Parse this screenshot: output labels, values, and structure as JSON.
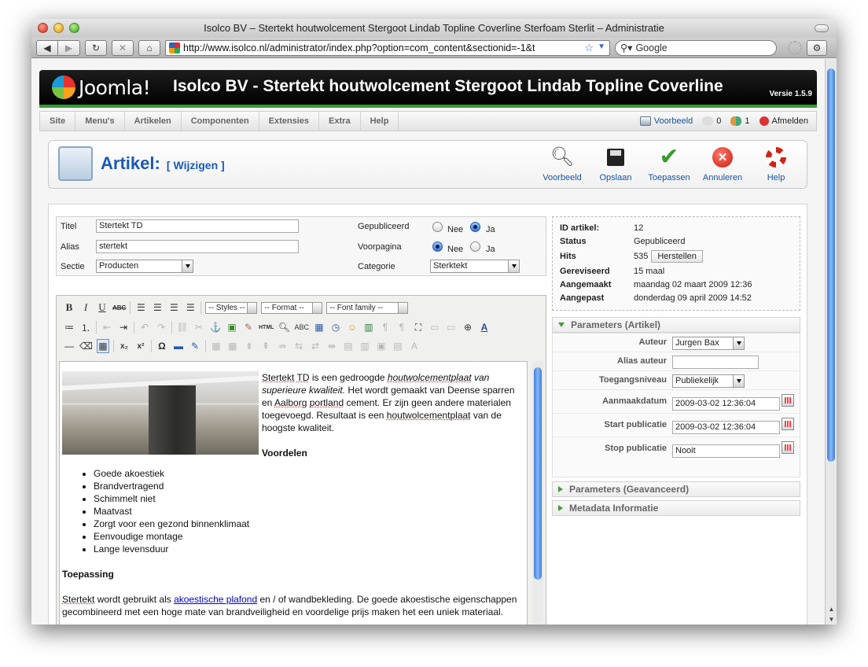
{
  "browser": {
    "title": "Isolco BV – Stertekt houtwolcement Stergoot Lindab Topline Coverline Sterfoam Sterlit – Administratie",
    "url": "http://www.isolco.nl/administrator/index.php?option=com_content&sectionid=-1&t",
    "search_placeholder": "Google"
  },
  "joomla": {
    "logo_text": "Joomla!",
    "site_title": "Isolco BV - Stertekt houtwolcement Stergoot Lindab Topline Coverline",
    "version": "Versie 1.5.9"
  },
  "menu": {
    "items": [
      "Site",
      "Menu's",
      "Artikelen",
      "Componenten",
      "Extensies",
      "Extra",
      "Help"
    ],
    "preview": "Voorbeeld",
    "messages_count": "0",
    "users_count": "1",
    "logout": "Afmelden"
  },
  "toolbar": {
    "title": "Artikel:",
    "subtitle": "[ Wijzigen ]",
    "actions": [
      {
        "label": "Voorbeeld",
        "icon": "magnifier-icon"
      },
      {
        "label": "Opslaan",
        "icon": "floppy-disk-icon"
      },
      {
        "label": "Toepassen",
        "icon": "checkmark-icon"
      },
      {
        "label": "Annuleren",
        "icon": "cancel-icon"
      },
      {
        "label": "Help",
        "icon": "lifebuoy-icon"
      }
    ]
  },
  "form": {
    "title_label": "Titel",
    "title_value": "Stertekt TD",
    "alias_label": "Alias",
    "alias_value": "stertekt",
    "section_label": "Sectie",
    "section_value": "Producten",
    "published_label": "Gepubliceerd",
    "frontpage_label": "Voorpagina",
    "category_label": "Categorie",
    "category_value": "Sterktekt",
    "no": "Nee",
    "yes": "Ja"
  },
  "info": {
    "id_label": "ID artikel:",
    "id_value": "12",
    "status_label": "Status",
    "status_value": "Gepubliceerd",
    "hits_label": "Hits",
    "hits_value": "535",
    "reset_label": "Herstellen",
    "revised_label": "Gereviseerd",
    "revised_value": "15 maal",
    "created_label": "Aangemaakt",
    "created_value": "maandag 02 maart 2009 12:36",
    "modified_label": "Aangepast",
    "modified_value": "donderdag 09 april 2009 14:52"
  },
  "editor": {
    "styles": "-- Styles --",
    "format": "-- Format --",
    "fontfamily": "-- Font family --",
    "p1_a": "Stertekt",
    "p1_b": "TD",
    "p1_c": " is een gedroogde ",
    "p1_d": "houtwolcementplaat",
    "p1_e": " van superieure kwaliteit.",
    "p1_f": " Het wordt gemaakt van Deense sparren en ",
    "p1_g": "Aalborg",
    "p1_h": "portland",
    "p1_i": " cement. Er zijn geen andere materialen toegevoegd. Resultaat is een ",
    "p1_j": "houtwolcementplaat",
    "p1_k": " van de hoogste kwaliteit.",
    "heading1": "Voordelen",
    "list": [
      "Goede akoestiek",
      "Brandvertragend",
      "Schimmelt niet",
      "Maatvast",
      "Zorgt voor een gezond binnenklimaat",
      "Eenvoudige montage",
      "Lange levensduur"
    ],
    "heading2": "Toepassing",
    "p2_a": "Stertekt",
    "p2_b": " wordt gebruikt als ",
    "p2_link": "akoestische plafond",
    "p2_c": " en / of wandbekleding. De goede akoestische eigenschappen gecombineerd met een hoge mate van brandveiligheid en voordelige prijs maken het een uniek materiaal."
  },
  "params": {
    "header1": "Parameters (Artikel)",
    "author_label": "Auteur",
    "author_value": "Jurgen Bax",
    "alias_author_label": "Alias auteur",
    "alias_author_value": "",
    "access_label": "Toegangsniveau",
    "access_value": "Publiekelijk",
    "created_label": "Aanmaakdatum",
    "created_value": "2009-03-02 12:36:04",
    "start_label": "Start publicatie",
    "start_value": "2009-03-02 12:36:04",
    "stop_label": "Stop publicatie",
    "stop_value": "Nooit",
    "header2": "Parameters (Geavanceerd)",
    "header3": "Metadata Informatie"
  }
}
